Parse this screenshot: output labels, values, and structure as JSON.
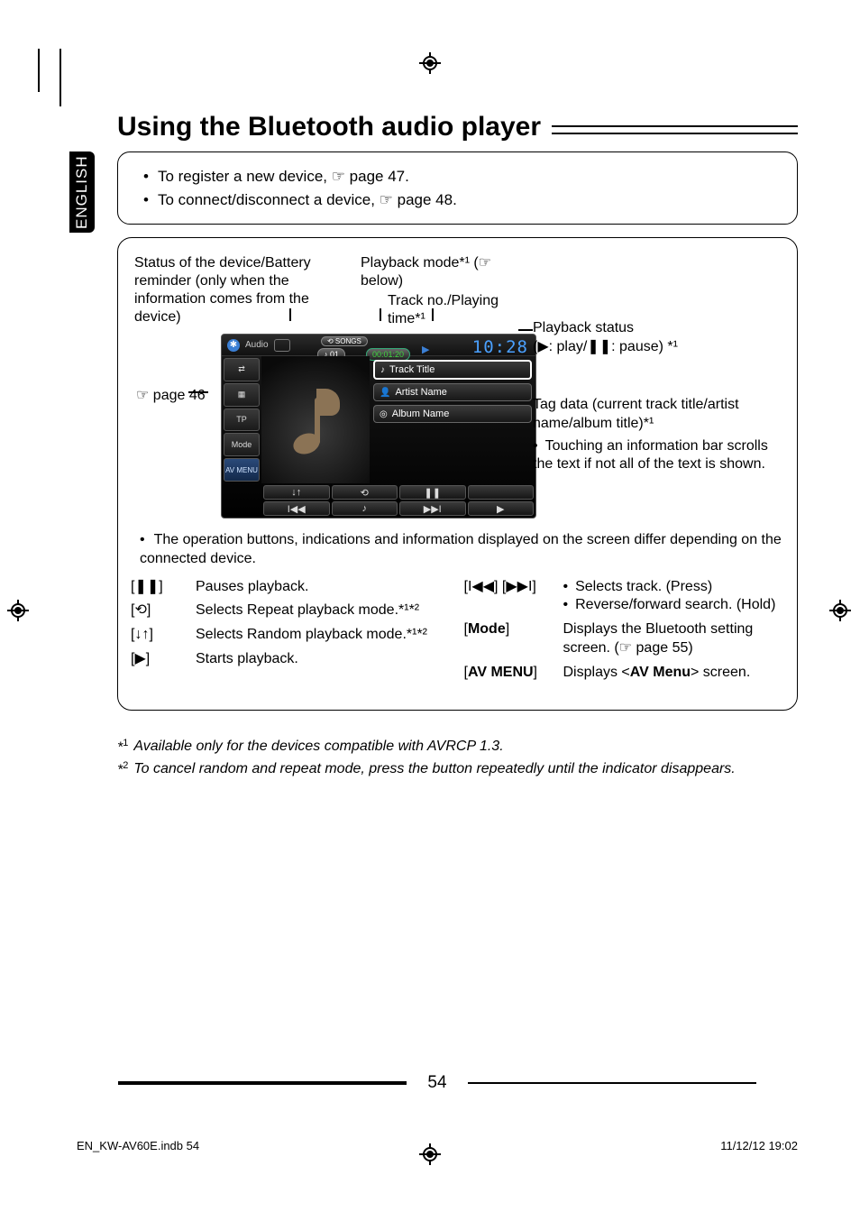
{
  "lang_tab": "ENGLISH",
  "title": "Using the Bluetooth audio player",
  "intro_box": {
    "line1": "To register a new device, ☞ page 47.",
    "line2": "To connect/disconnect a device, ☞ page 48."
  },
  "callouts": {
    "status": "Status of the device/Battery reminder (only when the information comes from the device)",
    "playback_mode": "Playback mode*¹ (☞ below)",
    "track_time": "Track no./Playing time*¹",
    "page46": "☞ page 46",
    "playback_status_label": "Playback status",
    "playback_status_detail": "(▶: play/❚❚: pause) *¹",
    "tag_label": "Tag data (current track title/artist name/album title)*¹",
    "tag_note": "Touching an information bar scrolls the text if not all of the text is shown."
  },
  "screen": {
    "source": "Audio",
    "songs_pill": "⟲ SONGS",
    "track_pill": "♪ 01",
    "time_pill": "00:01:20",
    "play_indicator": "▶",
    "clock": "10:28",
    "side": {
      "bt": "⇄",
      "grid": "▦",
      "tp": "TP",
      "mode": "Mode",
      "avmenu": "AV MENU"
    },
    "info": {
      "title": "Track Title",
      "artist": "Artist Name",
      "album": "Album Name"
    },
    "controls": {
      "shuffle": "↓↑",
      "repeat": "⟲",
      "pause": "❚❚",
      "blank": "",
      "prev": "I◀◀",
      "small": "♪",
      "next": "▶▶I",
      "play": "▶"
    }
  },
  "below_note": "The operation buttons, indications and information displayed on the screen differ depending on the connected device.",
  "buttons": {
    "left": [
      {
        "sym": "[❚❚]",
        "desc": "Pauses playback."
      },
      {
        "sym": "[⟲]",
        "desc": "Selects Repeat playback mode.*¹*²"
      },
      {
        "sym": "[↓↑]",
        "desc": "Selects Random playback mode.*¹*²"
      },
      {
        "sym": "[▶]",
        "desc": "Starts playback."
      }
    ],
    "right": [
      {
        "sym": "[I◀◀] [▶▶I]",
        "desc1": "Selects track. (Press)",
        "desc2": "Reverse/forward search. (Hold)"
      },
      {
        "sym": "[Mode]",
        "bold": "Mode",
        "desc": "Displays the Bluetooth setting screen. (☞ page 55)"
      },
      {
        "sym": "[AV MENU]",
        "bold": "AV MENU",
        "desc": "Displays <AV Menu> screen.",
        "descbold": "AV Menu"
      }
    ]
  },
  "footnotes": {
    "f1": "Available only for the devices compatible with AVRCP 1.3.",
    "f2": "To cancel random and repeat mode, press the button repeatedly until the indicator disappears."
  },
  "page_number": "54",
  "footer": {
    "file": "EN_KW-AV60E.indb   54",
    "date": "11/12/12   19:02"
  }
}
